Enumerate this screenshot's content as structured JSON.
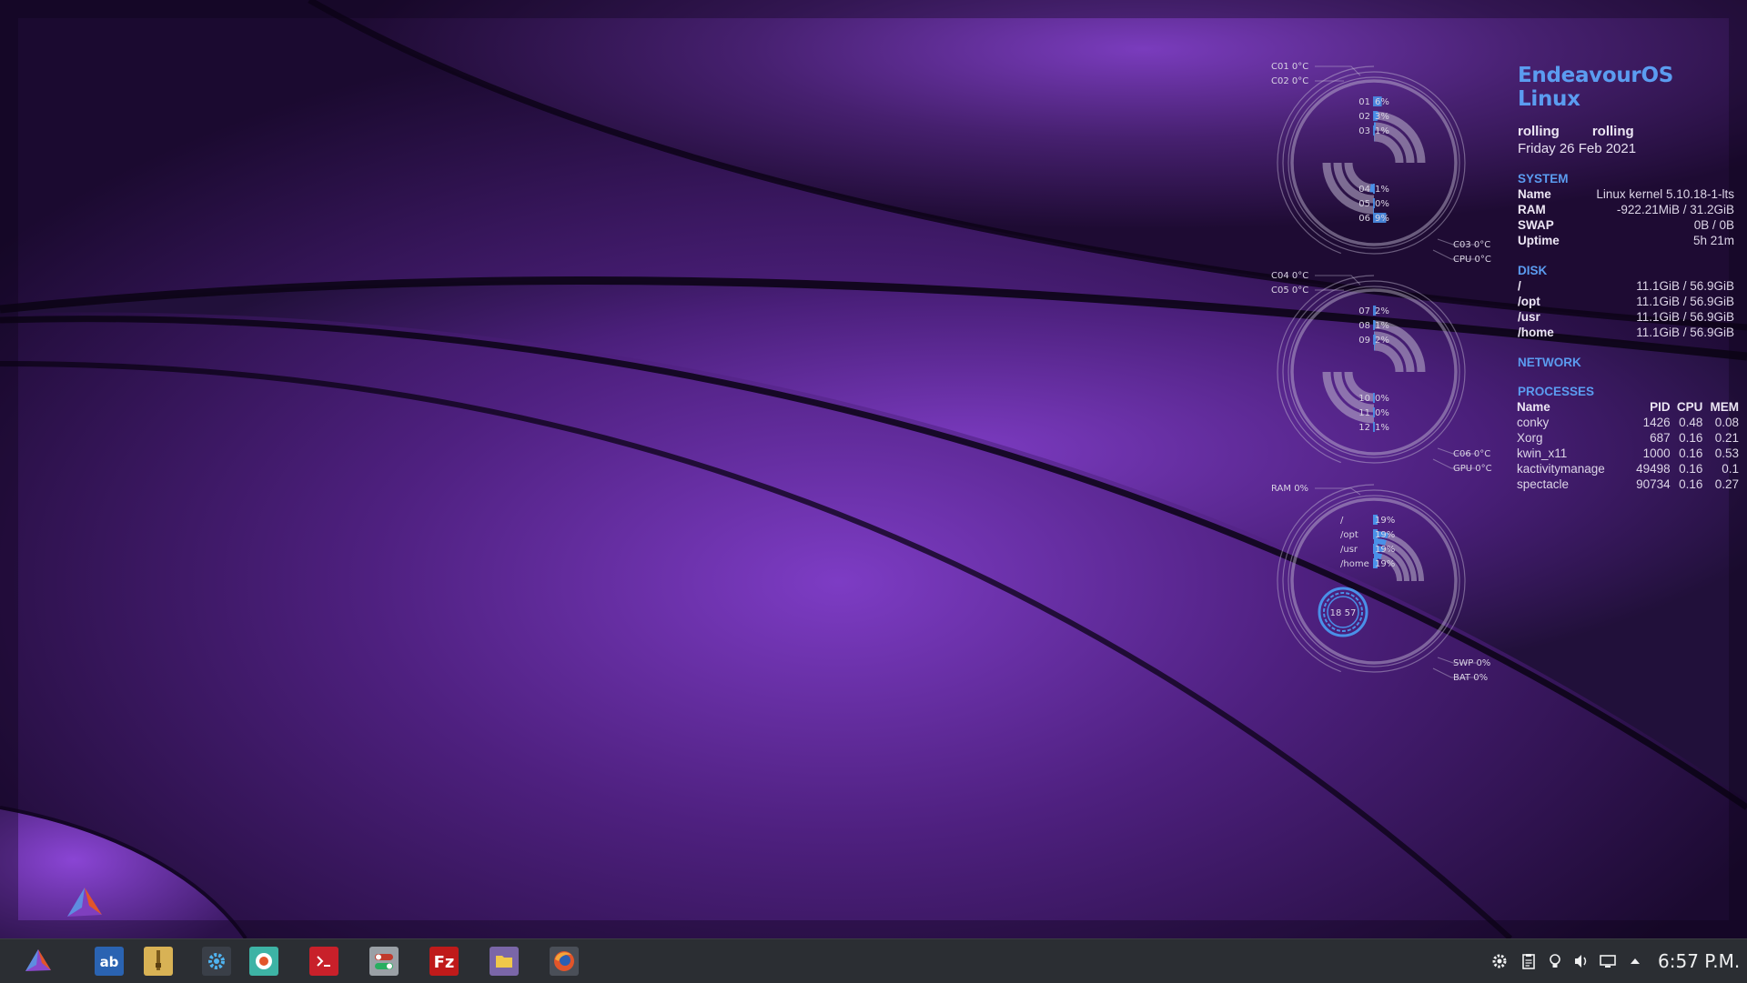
{
  "wallpaper": {
    "accent": "#7b3bbf",
    "shadow": "#12051f"
  },
  "sysinfo": {
    "title": "EndeavourOS Linux",
    "release_left": "rolling",
    "release_right": "rolling",
    "date": "Friday 26 Feb 2021",
    "system": {
      "header": "SYSTEM",
      "rows": [
        {
          "key": "Name",
          "value": "Linux kernel 5.10.18-1-lts"
        },
        {
          "key": "RAM",
          "value": "-922.21MiB / 31.2GiB"
        },
        {
          "key": "SWAP",
          "value": "0B / 0B"
        },
        {
          "key": "Uptime",
          "value": "5h 21m"
        }
      ]
    },
    "disk": {
      "header": "DISK",
      "rows": [
        {
          "key": "/",
          "value": "11.1GiB / 56.9GiB"
        },
        {
          "key": "/opt",
          "value": "11.1GiB / 56.9GiB"
        },
        {
          "key": "/usr",
          "value": "11.1GiB / 56.9GiB"
        },
        {
          "key": "/home",
          "value": "11.1GiB / 56.9GiB"
        }
      ]
    },
    "network": {
      "header": "NETWORK"
    },
    "processes": {
      "header": "PROCESSES",
      "columns": [
        "Name",
        "PID",
        "CPU",
        "MEM"
      ],
      "rows": [
        [
          "conky",
          "1426",
          "0.48",
          "0.08"
        ],
        [
          "Xorg",
          "687",
          "0.16",
          "0.21"
        ],
        [
          "kwin_x11",
          "1000",
          "0.16",
          "0.53"
        ],
        [
          "kactivitymanage",
          "49498",
          "0.16",
          "0.1"
        ],
        [
          "spectacle",
          "90734",
          "0.16",
          "0.27"
        ]
      ]
    }
  },
  "rings": {
    "ring1": {
      "top_labels": [
        "C01 0°C",
        "C02 0°C"
      ],
      "bottom_labels": [
        "C03 0°C",
        "CPU 0°C"
      ],
      "upper_cores": [
        {
          "id": "01",
          "pct": "6%",
          "value": 6
        },
        {
          "id": "02",
          "pct": "3%",
          "value": 3
        },
        {
          "id": "03",
          "pct": "1%",
          "value": 1
        }
      ],
      "lower_cores": [
        {
          "id": "04",
          "pct": "1%",
          "value": 1
        },
        {
          "id": "05",
          "pct": "0%",
          "value": 0
        },
        {
          "id": "06",
          "pct": "9%",
          "value": 9
        }
      ]
    },
    "ring2": {
      "top_labels": [
        "C04 0°C",
        "C05 0°C"
      ],
      "bottom_labels": [
        "C06 0°C",
        "GPU 0°C"
      ],
      "upper_cores": [
        {
          "id": "07",
          "pct": "2%",
          "value": 2
        },
        {
          "id": "08",
          "pct": "1%",
          "value": 1
        },
        {
          "id": "09",
          "pct": "2%",
          "value": 2
        }
      ],
      "lower_cores": [
        {
          "id": "10",
          "pct": "0%",
          "value": 0
        },
        {
          "id": "11",
          "pct": "0%",
          "value": 0
        },
        {
          "id": "12",
          "pct": "1%",
          "value": 1
        }
      ]
    },
    "ring3": {
      "top_label": "RAM 0%",
      "bottom_labels": [
        "SWP 0%",
        "BAT 0%"
      ],
      "disks": [
        {
          "name": "/",
          "pct": "19%",
          "value": 19
        },
        {
          "name": "/opt",
          "pct": "19%",
          "value": 19
        },
        {
          "name": "/usr",
          "pct": "19%",
          "value": 19
        },
        {
          "name": "/home",
          "pct": "19%",
          "value": 19
        }
      ],
      "clock": "18 57"
    }
  },
  "taskbar": {
    "launcher_icon": "endeavouros-logo-icon",
    "apps": [
      {
        "name": "discover-icon",
        "color": "#2a63b2"
      },
      {
        "name": "archive-manager-icon",
        "color": "#d8b255"
      },
      {
        "name": "system-settings-icon",
        "color": "#3a3f48"
      },
      {
        "name": "software-updater-icon",
        "color": "#3db3a5"
      },
      {
        "name": "terminal-icon",
        "color": "#c8202a"
      },
      {
        "name": "toggle-settings-icon",
        "color": "#9aa0a6"
      },
      {
        "name": "filezilla-icon",
        "color": "#bf1a1a"
      },
      {
        "name": "file-manager-icon",
        "color": "#7a66a8"
      },
      {
        "name": "firefox-icon",
        "color": "#e2552a"
      }
    ],
    "tray": [
      "settings-gear-icon",
      "clipboard-icon",
      "night-color-icon",
      "volume-icon",
      "display-icon",
      "expand-arrow-icon"
    ],
    "clock": "6:57 P.M."
  }
}
